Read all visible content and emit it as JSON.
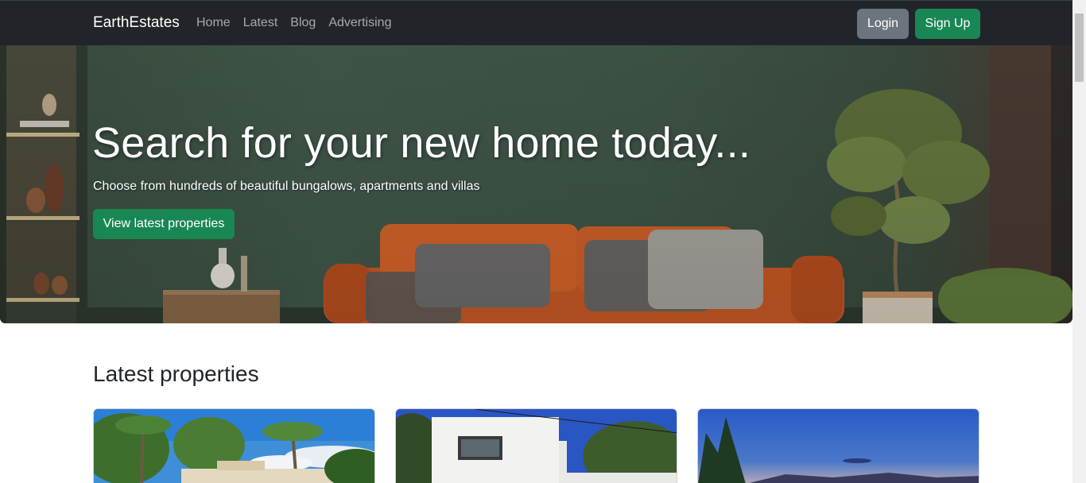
{
  "navbar": {
    "brand": "EarthEstates",
    "links": [
      "Home",
      "Latest",
      "Blog",
      "Advertising"
    ],
    "login_label": "Login",
    "signup_label": "Sign Up"
  },
  "hero": {
    "title": "Search for your new home today...",
    "subtitle": "Choose from hundreds of beautiful bungalows, apartments and villas",
    "cta_label": "View latest properties"
  },
  "latest": {
    "title": "Latest properties"
  },
  "colors": {
    "navbar_bg": "#212529",
    "primary_green": "#198754",
    "secondary_gray": "#6c757d"
  }
}
